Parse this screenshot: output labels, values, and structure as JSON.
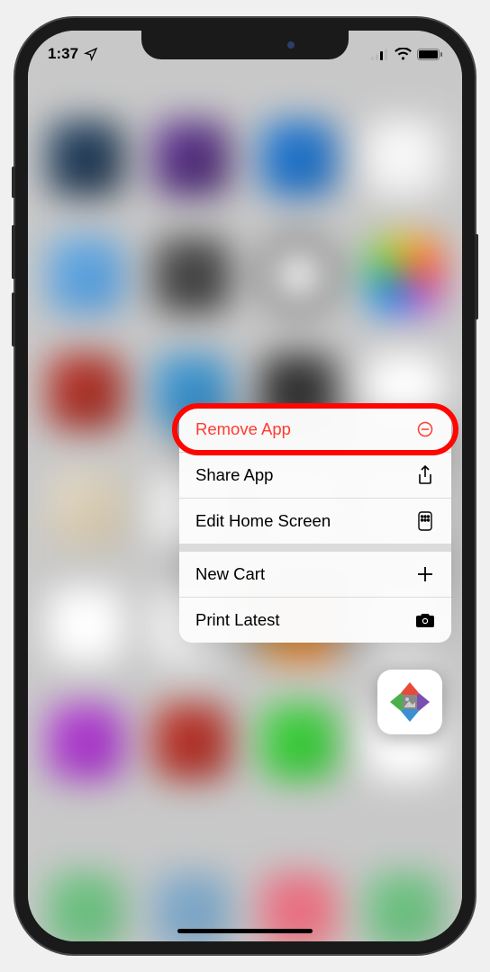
{
  "status": {
    "time": "1:37",
    "location_glyph": "✈"
  },
  "menu": {
    "remove_app": "Remove App",
    "share_app": "Share App",
    "edit_home_screen": "Edit Home Screen",
    "new_cart": "New Cart",
    "print_latest": "Print Latest"
  },
  "highlight": {
    "color": "#ff0600"
  }
}
